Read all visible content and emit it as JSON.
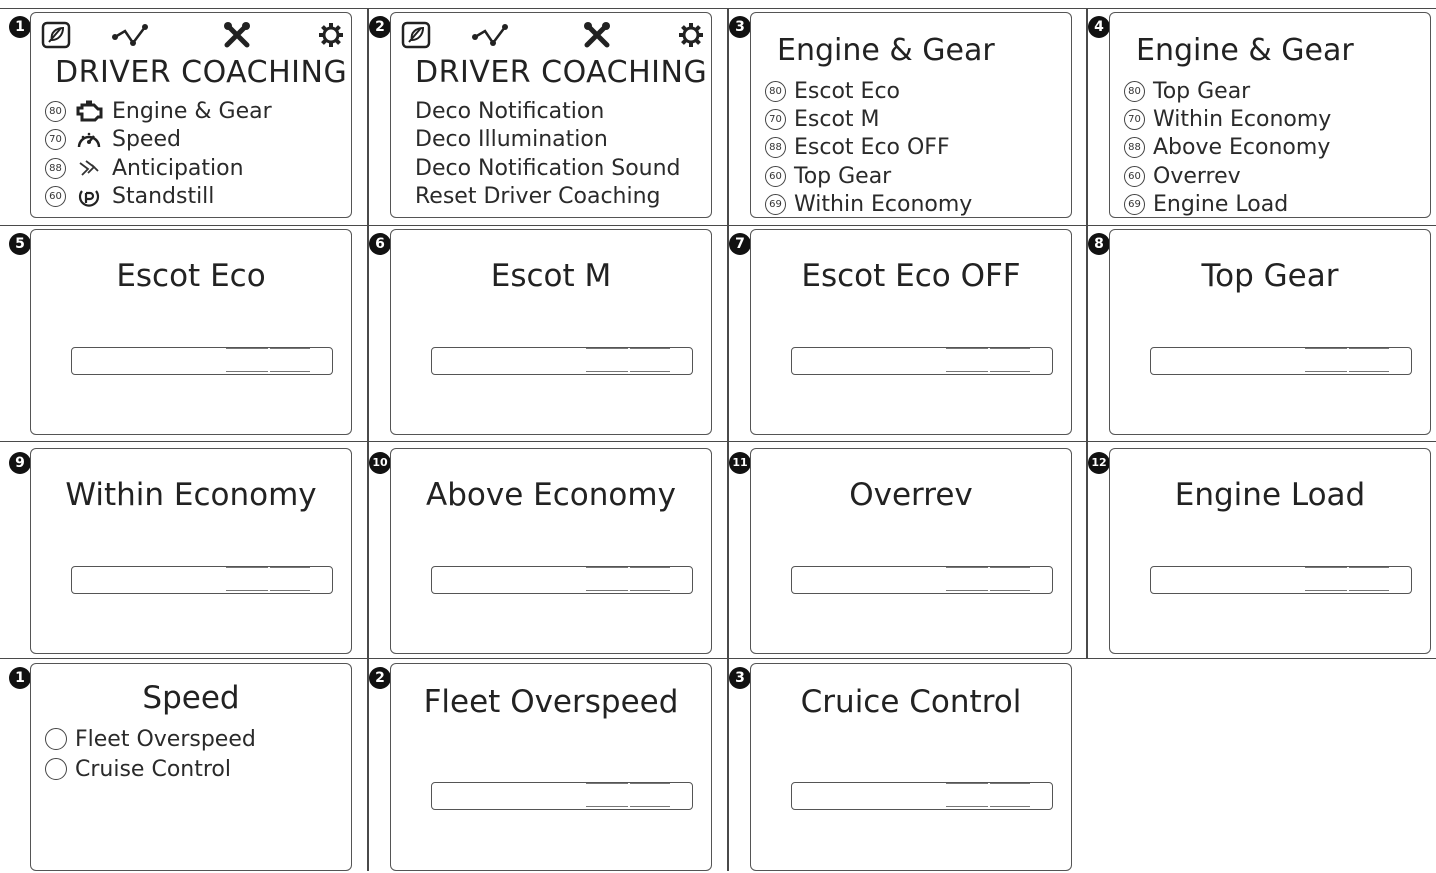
{
  "row1": {
    "panel1": {
      "badge": "1",
      "header": "DRIVER COACHING",
      "items": [
        {
          "num": "80",
          "icon": "engine-icon",
          "label": "Engine & Gear"
        },
        {
          "num": "70",
          "icon": "speedometer-icon",
          "label": "Speed"
        },
        {
          "num": "88",
          "icon": "anticipation-icon",
          "label": "Anticipation"
        },
        {
          "num": "60",
          "icon": "standstill-icon",
          "label": "Standstill"
        }
      ]
    },
    "panel2": {
      "badge": "2",
      "header": "DRIVER COACHING",
      "items": [
        "Deco Notification",
        "Deco Illumination",
        "Deco Notification Sound",
        "Reset Driver Coaching"
      ]
    },
    "panel3": {
      "badge": "3",
      "title": "Engine & Gear",
      "items": [
        {
          "num": "80",
          "label": "Escot Eco"
        },
        {
          "num": "70",
          "label": "Escot M"
        },
        {
          "num": "88",
          "label": "Escot Eco OFF"
        },
        {
          "num": "60",
          "label": "Top Gear"
        },
        {
          "num": "69",
          "label": "Within Economy"
        }
      ]
    },
    "panel4": {
      "badge": "4",
      "title": "Engine & Gear",
      "items": [
        {
          "num": "80",
          "label": "Top Gear"
        },
        {
          "num": "70",
          "label": "Within Economy"
        },
        {
          "num": "88",
          "label": "Above Economy"
        },
        {
          "num": "60",
          "label": "Overrev"
        },
        {
          "num": "69",
          "label": "Engine Load"
        }
      ]
    }
  },
  "row2": [
    {
      "badge": "5",
      "title": "Escot Eco"
    },
    {
      "badge": "6",
      "title": "Escot M"
    },
    {
      "badge": "7",
      "title": "Escot Eco OFF"
    },
    {
      "badge": "8",
      "title": "Top Gear"
    }
  ],
  "row3": [
    {
      "badge": "9",
      "title": "Within Economy"
    },
    {
      "badge": "10",
      "title": "Above Economy"
    },
    {
      "badge": "11",
      "title": "Overrev"
    },
    {
      "badge": "12",
      "title": "Engine Load"
    }
  ],
  "row4": {
    "panel1": {
      "badge": "1",
      "title": "Speed",
      "options": [
        "Fleet Overspeed",
        "Cruise Control"
      ]
    },
    "panel2": {
      "badge": "2",
      "title": "Fleet Overspeed"
    },
    "panel3": {
      "badge": "3",
      "title": "Cruice Control"
    }
  },
  "colors": {
    "line": "#4a4a4a",
    "badge": "#111111",
    "text": "#2a2a2a"
  }
}
